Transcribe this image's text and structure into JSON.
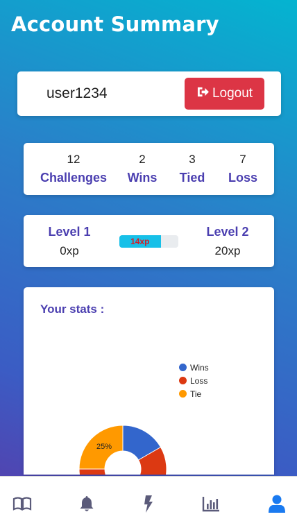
{
  "page": {
    "title": "Account Summary"
  },
  "user": {
    "username": "user1234",
    "logout_label": "Logout"
  },
  "stats": [
    {
      "value": "12",
      "label": "Challenges"
    },
    {
      "value": "2",
      "label": "Wins"
    },
    {
      "value": "3",
      "label": "Tied"
    },
    {
      "value": "7",
      "label": "Loss"
    }
  ],
  "level": {
    "current": {
      "name": "Level 1",
      "xp": "0xp"
    },
    "next": {
      "name": "Level 2",
      "xp": "20xp"
    },
    "progress_label": "14xp",
    "progress_fraction": 0.7
  },
  "chart": {
    "title": "Your stats :"
  },
  "chart_data": {
    "type": "pie",
    "donut": true,
    "series": [
      {
        "name": "Wins",
        "value": 2,
        "color": "#3366cc"
      },
      {
        "name": "Loss",
        "value": 7,
        "color": "#dc3912"
      },
      {
        "name": "Tie",
        "value": 3,
        "color": "#ff9900"
      }
    ],
    "slice_labels": [
      "25%"
    ],
    "legend_position": "right"
  },
  "nav": {
    "items": [
      {
        "icon": "book-icon",
        "active": false
      },
      {
        "icon": "bell-icon",
        "active": false
      },
      {
        "icon": "bolt-icon",
        "active": false
      },
      {
        "icon": "bar-chart-icon",
        "active": false
      },
      {
        "icon": "user-icon",
        "active": true
      }
    ],
    "colors": {
      "inactive": "#5b5b7a",
      "active": "#1a7af0"
    }
  }
}
